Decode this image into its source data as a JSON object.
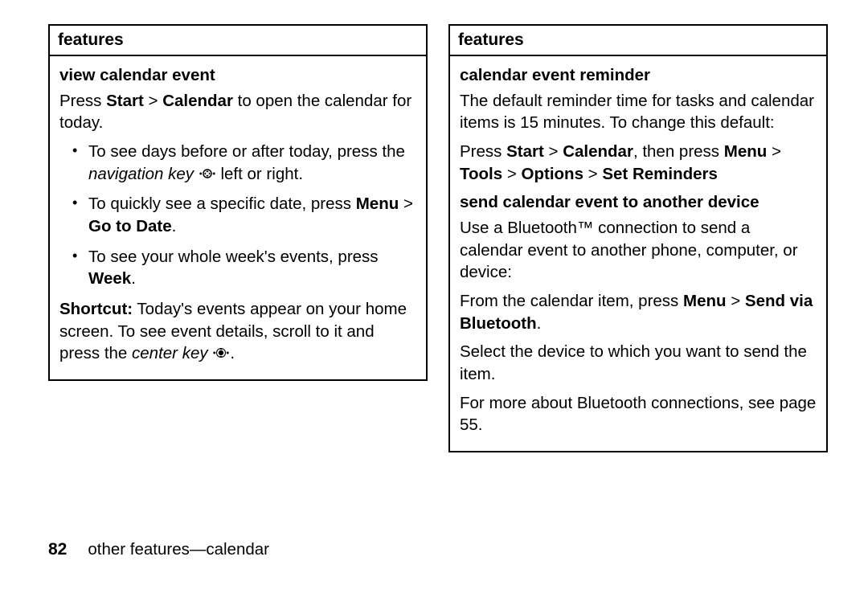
{
  "left": {
    "header": "features",
    "section1_title": "view calendar event",
    "p1_a": "Press ",
    "p1_b": "Start",
    "p1_c": " > ",
    "p1_d": "Calendar",
    "p1_e": " to open the calendar for today.",
    "li1_a": "To see days before or after today, press the ",
    "li1_b": "navigation key",
    "li1_c": " left or right.",
    "li2_a": "To quickly see a specific date, press ",
    "li2_b": "Menu",
    "li2_c": " > ",
    "li2_d": "Go to Date",
    "li2_e": ".",
    "li3_a": "To see your whole week's events, press ",
    "li3_b": "Week",
    "li3_c": ".",
    "shortcut_label": "Shortcut:",
    "shortcut_a": " Today's events appear on your home screen. To see event details, scroll to it and press the ",
    "shortcut_b": "center key",
    "shortcut_c": "."
  },
  "right": {
    "header": "features",
    "section1_title": "calendar event reminder",
    "p1": "The default reminder time for tasks and calendar items is 15 minutes. To change this default:",
    "p2_a": "Press ",
    "p2_b": "Start",
    "p2_c": " > ",
    "p2_d": "Calendar",
    "p2_e": ", then press ",
    "p2_f": "Menu",
    "p2_g": " > ",
    "p2_h": "Tools",
    "p2_i": " > ",
    "p2_j": "Options",
    "p2_k": " > ",
    "p2_l": "Set Reminders",
    "section2_title": "send calendar event to another device",
    "p3": "Use a Bluetooth™ connection to send a calendar event to another phone, computer, or device:",
    "p4_a": "From the calendar item, press ",
    "p4_b": "Menu",
    "p4_c": " > ",
    "p4_d": "Send via Bluetooth",
    "p4_e": ".",
    "p5": "Select the device to which you want to send the item.",
    "p6": "For more about Bluetooth connections, see page 55."
  },
  "footer": {
    "page_number": "82",
    "section": "other features—calendar"
  }
}
